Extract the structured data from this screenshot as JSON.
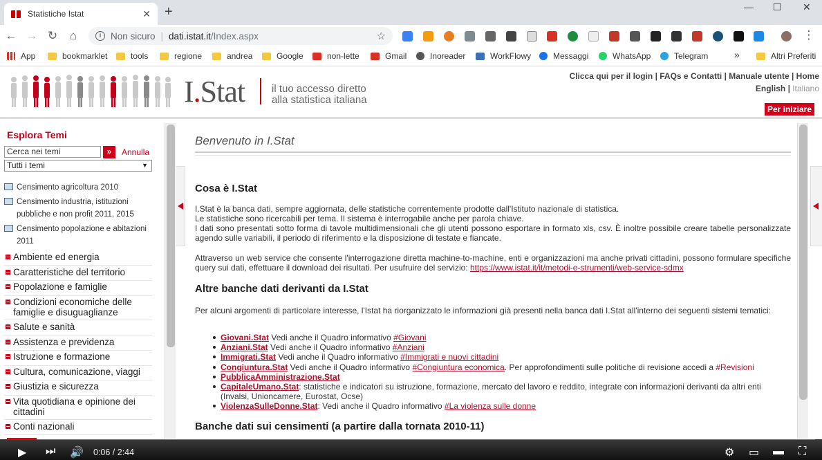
{
  "browser": {
    "tab_title": "Statistiche Istat",
    "tab_close": "✕",
    "new_tab": "+",
    "win_minimize": "—",
    "win_maximize": "☐",
    "win_close": "✕",
    "security_label": "Non sicuro",
    "url_host": "dati.istat.it",
    "url_path": "/Index.aspx",
    "bookmarks": [
      {
        "label": "App",
        "icon": "apps-grid-icon"
      },
      {
        "label": "bookmarklet",
        "icon": "folder-icon"
      },
      {
        "label": "tools",
        "icon": "folder-icon"
      },
      {
        "label": "regione",
        "icon": "folder-icon"
      },
      {
        "label": "andrea",
        "icon": "folder-icon"
      },
      {
        "label": "Google",
        "icon": "folder-icon"
      },
      {
        "label": "non-lette",
        "icon": "gmail-icon"
      },
      {
        "label": "Gmail",
        "icon": "gmail-icon"
      },
      {
        "label": "Inoreader",
        "icon": "inoreader-icon"
      },
      {
        "label": "WorkFlowy",
        "icon": "workflowy-icon"
      },
      {
        "label": "Messaggi",
        "icon": "messages-icon"
      },
      {
        "label": "WhatsApp",
        "icon": "whatsapp-icon"
      },
      {
        "label": "Telegram",
        "icon": "telegram-icon"
      }
    ],
    "bookmarks_more": "»",
    "other_bookmarks": "Altri Preferiti"
  },
  "header": {
    "logo_text_1": "I",
    "logo_text_2": ".",
    "logo_text_3": "Stat",
    "tagline_1": "il tuo accesso diretto",
    "tagline_2": "alla statistica italiana",
    "top_links": "Clicca qui per il login | FAQs e Contatti | Manuale utente | Home",
    "lang_en": "English",
    "lang_sep": " | ",
    "lang_it": "Italiano",
    "start_button": "Per iniziare"
  },
  "sidebar": {
    "title": "Esplora Temi",
    "search_value": "Cerca nei temi",
    "search_go": "»",
    "cancel": "Annulla",
    "filter_value": "Tutti i temi",
    "census": [
      {
        "label_1": "Censimento agricoltura 2010",
        "label_2": ""
      },
      {
        "label_1": "Censimento industria, istituzioni",
        "label_2": "pubbliche e non profit 2011, 2015"
      },
      {
        "label_1": "Censimento popolazione e abitazioni",
        "label_2": "2011"
      }
    ],
    "themes": [
      {
        "label": "Ambiente ed energia"
      },
      {
        "label": "Caratteristiche del territorio"
      },
      {
        "label": "Popolazione e famiglie"
      },
      {
        "label": "Condizioni economiche delle famiglie e disuguaglianze"
      },
      {
        "label": "Salute e sanità"
      },
      {
        "label": "Assistenza e previdenza"
      },
      {
        "label": "Istruzione e formazione"
      },
      {
        "label": "Cultura, comunicazione, viaggi"
      },
      {
        "label": "Giustizia e sicurezza"
      },
      {
        "label": "Vita quotidiana e opinione dei cittadini"
      },
      {
        "label": "Conti nazionali"
      }
    ]
  },
  "main": {
    "welcome": "Benvenuto in I.Stat",
    "section1_title": "Cosa è I.Stat",
    "section1_p1": "I.Stat è la banca dati, sempre aggiornata, delle statistiche correntemente prodotte dall'Istituto nazionale di statistica.",
    "section1_p2": "Le statistiche sono ricercabili per tema. Il sistema è interrogabile anche per parola chiave.",
    "section1_p3": "I dati sono presentati sotto forma di tavole multidimensionali che gli utenti possono esportare in formato xls, csv. È inoltre possibile creare tabelle personalizzate agendo sulle variabili, il periodo di riferimento e la disposizione di testate e fiancate.",
    "section1_p4": "Attraverso un web service che consente l'interrogazione diretta machine-to-machine, enti e organizzazioni ma anche privati cittadini, possono formulare specifiche query sui dati, effettuare il download dei risultati. Per usufruire del servizio: ",
    "section1_link": "https://www.istat.it/it/metodi-e-strumenti/web-service-sdmx",
    "section2_title": "Altre banche dati derivanti da I.Stat",
    "section2_p": "Per alcuni argomenti di particolare interesse, l'Istat ha riorganizzato le informazioni già presenti nella banca dati I.Stat all'interno dei seguenti sistemi tematici:",
    "items": [
      {
        "name": "Giovani.Stat",
        "text": " Vedi anche il Quadro informativo ",
        "tag": "#Giovani",
        "extra": "",
        "extra_link": ""
      },
      {
        "name": "Anziani.Stat",
        "text": " Vedi anche il Quadro informativo ",
        "tag": "#Anziani",
        "extra": "",
        "extra_link": ""
      },
      {
        "name": "Immigrati.Stat",
        "text": " Vedi anche il Quadro informativo ",
        "tag": "#Immigrati e nuovi cittadini",
        "extra": "",
        "extra_link": ""
      },
      {
        "name": "Congiuntura.Stat",
        "text": " Vedi anche il Quadro informativo ",
        "tag": "#Congiuntura economica",
        "extra": ". Per approfondimenti sulle politiche di revisione accedi a ",
        "extra_link": "#Revisioni"
      },
      {
        "name": "PubblicaAmministrazione.Stat",
        "text": "",
        "tag": "",
        "extra": "",
        "extra_link": ""
      },
      {
        "name": "CapitaleUmano.Stat",
        "text": ": statistiche e indicatori su istruzione, formazione, mercato del lavoro e reddito, integrate con informazioni derivanti da altri enti (Invalsi, Unioncamere, Eurostat, Ocse)",
        "tag": "",
        "extra": "",
        "extra_link": ""
      },
      {
        "name": "ViolenzaSulleDonne.Stat",
        "text": ": Vedi anche il Quadro informativo ",
        "tag": "#La violenza sulle donne",
        "extra": "",
        "extra_link": ""
      }
    ],
    "section3_title": "Banche dati sui censimenti (a partire dalla tornata 2010-11)"
  },
  "player": {
    "time": "0:06 / 2:44",
    "progress": 0.037
  },
  "colors": {
    "accent": "#d0021b",
    "link": "#b0102a"
  }
}
